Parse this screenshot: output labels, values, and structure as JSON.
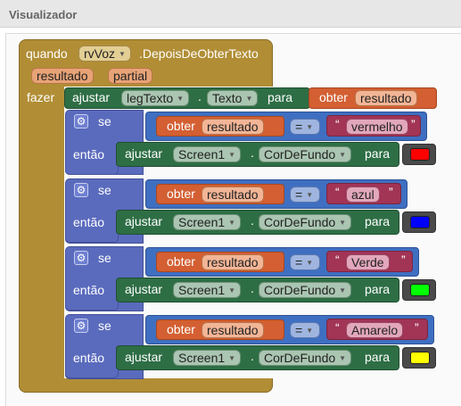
{
  "title": "Visualizador",
  "event": {
    "when_label": "quando",
    "component": "rvVoz",
    "event_name": ".DepoisDeObterTexto",
    "params": [
      "resultado",
      "partial"
    ],
    "do_label": "fazer"
  },
  "set_label": {
    "set": "ajustar",
    "component": "legTexto",
    "dot": ".",
    "property": "Texto",
    "to": "para",
    "get": "obter",
    "var": "resultado"
  },
  "if_blocks": [
    {
      "if_label": "se",
      "then_label": "então",
      "get": "obter",
      "var": "resultado",
      "op": "=",
      "value": "vermelho",
      "set": "ajustar",
      "component": "Screen1",
      "dot": ".",
      "property": "CorDeFundo",
      "to": "para",
      "color": "#ff0000"
    },
    {
      "if_label": "se",
      "then_label": "então",
      "get": "obter",
      "var": "resultado",
      "op": "=",
      "value": "azul",
      "set": "ajustar",
      "component": "Screen1",
      "dot": ".",
      "property": "CorDeFundo",
      "to": "para",
      "color": "#0000ff"
    },
    {
      "if_label": "se",
      "then_label": "então",
      "get": "obter",
      "var": "resultado",
      "op": "=",
      "value": "Verde",
      "set": "ajustar",
      "component": "Screen1",
      "dot": ".",
      "property": "CorDeFundo",
      "to": "para",
      "color": "#00ff00"
    },
    {
      "if_label": "se",
      "then_label": "então",
      "get": "obter",
      "var": "resultado",
      "op": "=",
      "value": "Amarelo",
      "set": "ajustar",
      "component": "Screen1",
      "dot": ".",
      "property": "CorDeFundo",
      "to": "para",
      "color": "#ffff00"
    }
  ],
  "icons": {
    "mutator": "gear-icon",
    "dropdown": "dropdown-arrow-icon"
  },
  "colors": {
    "event": "#b18e35",
    "control": "#5a6bbd",
    "setter": "#2e6e45",
    "getter": "#d35f32",
    "compare": "#3f6fc1",
    "text": "#a23456"
  }
}
